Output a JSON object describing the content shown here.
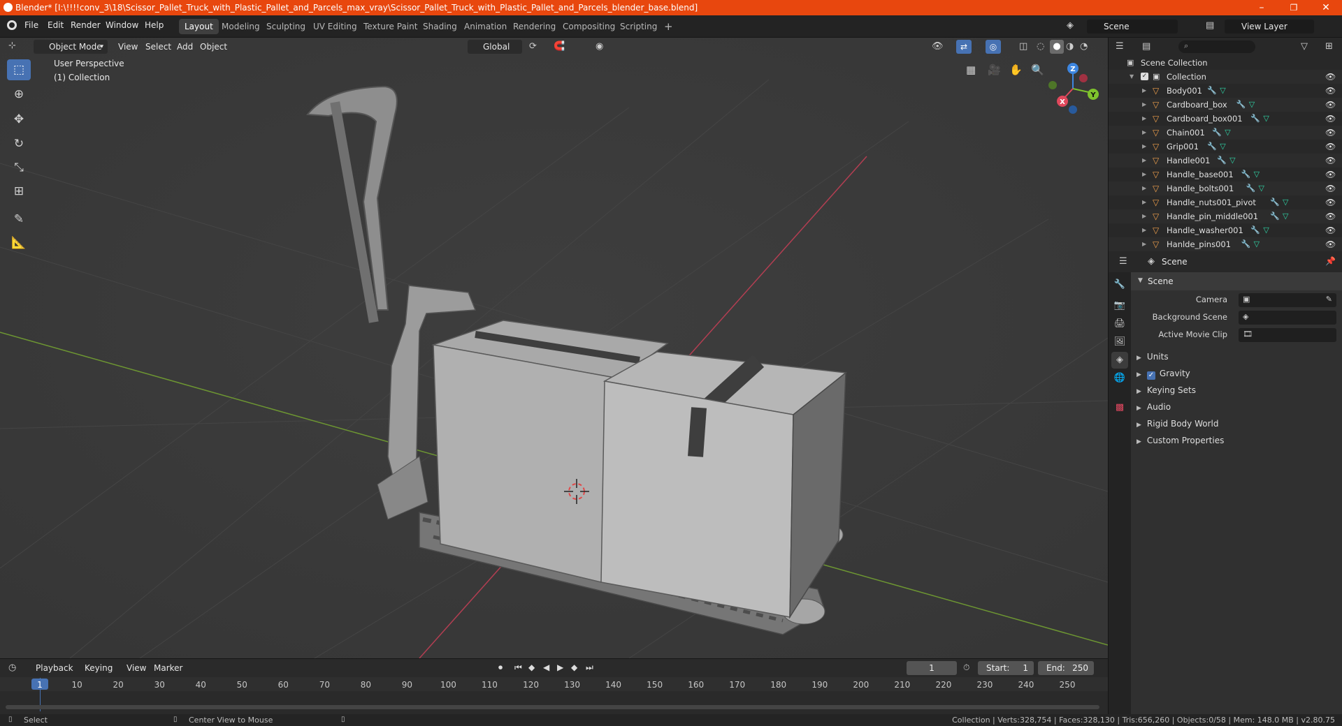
{
  "window": {
    "title": "Blender* [I:\\!!!!conv_3\\18\\Scissor_Pallet_Truck_with_Plastic_Pallet_and_Parcels_max_vray\\Scissor_Pallet_Truck_with_Plastic_Pallet_and_Parcels_blender_base.blend]",
    "minimize": "–",
    "maximize": "❐",
    "close": "✕"
  },
  "menu": [
    "File",
    "Edit",
    "Render",
    "Window",
    "Help"
  ],
  "workspaces": [
    "Layout",
    "Modeling",
    "Sculpting",
    "UV Editing",
    "Texture Paint",
    "Shading",
    "Animation",
    "Rendering",
    "Compositing",
    "Scripting"
  ],
  "add_workspace": "+",
  "scene_field": "Scene",
  "view_layer_field": "View Layer",
  "viewport_header": {
    "mode": "Object Mode",
    "view": "View",
    "select": "Select",
    "add": "Add",
    "object": "Object",
    "orientation": "Global"
  },
  "viewport_overlay": {
    "perspective": "User Perspective",
    "collection": "(1) Collection"
  },
  "gizmo": {
    "x": "X",
    "y": "Y",
    "z": "Z"
  },
  "tools": [
    "select-box",
    "cursor",
    "move",
    "rotate",
    "scale",
    "transform",
    "annotate",
    "measure"
  ],
  "timeline": {
    "playback": "Playback",
    "keying": "Keying",
    "view": "View",
    "marker": "Marker",
    "current_frame": "1",
    "start_label": "Start:",
    "start": "1",
    "end_label": "End:",
    "end": "250",
    "ruler": [
      "1",
      "10",
      "20",
      "30",
      "40",
      "50",
      "60",
      "70",
      "80",
      "90",
      "100",
      "110",
      "120",
      "130",
      "140",
      "150",
      "160",
      "170",
      "180",
      "190",
      "200",
      "210",
      "220",
      "230",
      "240",
      "250"
    ]
  },
  "statusbar": {
    "select": "Select",
    "center_view": "Center View to Mouse",
    "stats": "Collection | Verts:328,754 | Faces:328,130 | Tris:656,260 | Objects:0/58 | Mem: 148.0 MB | v2.80.75"
  },
  "outliner": {
    "root": "Scene Collection",
    "collection": "Collection",
    "items": [
      "Body001",
      "Cardboard_box",
      "Cardboard_box001",
      "Chain001",
      "Grip001",
      "Handle001",
      "Handle_base001",
      "Handle_bolts001",
      "Handle_nuts001_pivot",
      "Handle_pin_middle001",
      "Handle_washer001",
      "Hanlde_pins001"
    ]
  },
  "properties": {
    "header": "Scene",
    "panel": "Scene",
    "camera_label": "Camera",
    "background_label": "Background Scene",
    "movie_clip_label": "Active Movie Clip",
    "sections": [
      "Units",
      "Gravity",
      "Keying Sets",
      "Audio",
      "Rigid Body World",
      "Custom Properties"
    ],
    "gravity_checked": true
  },
  "colors": {
    "titlebar": "#e8470e",
    "active_tool": "#4772b3",
    "axis_x": "#e0485c",
    "axis_y": "#7fc32d",
    "axis_z": "#3d86e0"
  }
}
